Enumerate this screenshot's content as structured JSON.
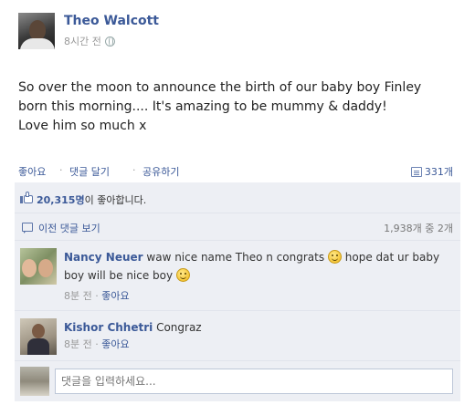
{
  "post": {
    "author": "Theo Walcott",
    "timestamp": "8시간 전",
    "privacy_icon": "globe-icon",
    "body_lines": [
      "So over the moon to announce the birth of our baby boy Finley",
      "born this morning.... It's amazing to be mummy & daddy!",
      "Love him so much x"
    ]
  },
  "actions": {
    "like": "좋아요",
    "comment": "댓글 달기",
    "share": "공유하기",
    "separator": "·",
    "share_count": "331개"
  },
  "likes": {
    "count": "20,315명",
    "suffix": "이 좋아합니다."
  },
  "previous_comments": {
    "link": "이전 댓글 보기",
    "count": "1,938개 중 2개"
  },
  "comments": [
    {
      "author": "Nancy Neuer",
      "text_a": "waw nice name Theo n congrats",
      "text_b": "hope dat ur baby boy will be nice boy",
      "time": "8분 전",
      "like": "좋아요"
    },
    {
      "author": "Kishor Chhetri",
      "text_a": "Congraz",
      "time": "8분 전",
      "like": "좋아요"
    }
  ],
  "compose": {
    "placeholder": "댓글을 입력하세요..."
  },
  "colors": {
    "link": "#3b5998",
    "ufi_background": "#edeff4"
  }
}
